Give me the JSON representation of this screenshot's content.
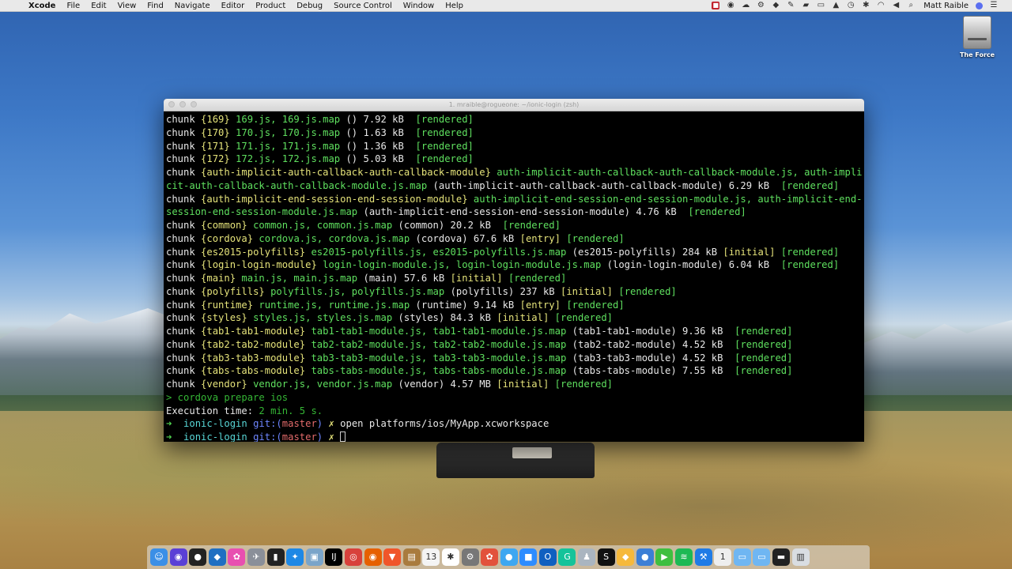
{
  "menubar": {
    "apple": "",
    "app_name": "Xcode",
    "items": [
      "File",
      "Edit",
      "View",
      "Find",
      "Navigate",
      "Editor",
      "Product",
      "Debug",
      "Source Control",
      "Window",
      "Help"
    ],
    "user": "Matt Raible"
  },
  "desktop": {
    "disk_label": "The Force"
  },
  "terminal": {
    "title": "1. mraible@rogueone: ~/ionic-login (zsh)",
    "lines": [
      [
        {
          "t": "chunk ",
          "c": "w"
        },
        {
          "t": "{169}",
          "c": "y"
        },
        {
          "t": " 169.js, 169.js.map ",
          "c": "g"
        },
        {
          "t": "() 7.92 kB ",
          "c": "w"
        },
        {
          "t": " [rendered]",
          "c": "g"
        }
      ],
      [
        {
          "t": "chunk ",
          "c": "w"
        },
        {
          "t": "{170}",
          "c": "y"
        },
        {
          "t": " 170.js, 170.js.map ",
          "c": "g"
        },
        {
          "t": "() 1.63 kB ",
          "c": "w"
        },
        {
          "t": " [rendered]",
          "c": "g"
        }
      ],
      [
        {
          "t": "chunk ",
          "c": "w"
        },
        {
          "t": "{171}",
          "c": "y"
        },
        {
          "t": " 171.js, 171.js.map ",
          "c": "g"
        },
        {
          "t": "() 1.36 kB ",
          "c": "w"
        },
        {
          "t": " [rendered]",
          "c": "g"
        }
      ],
      [
        {
          "t": "chunk ",
          "c": "w"
        },
        {
          "t": "{172}",
          "c": "y"
        },
        {
          "t": " 172.js, 172.js.map ",
          "c": "g"
        },
        {
          "t": "() 5.03 kB ",
          "c": "w"
        },
        {
          "t": " [rendered]",
          "c": "g"
        }
      ],
      [
        {
          "t": "chunk ",
          "c": "w"
        },
        {
          "t": "{auth-implicit-auth-callback-auth-callback-module}",
          "c": "y"
        },
        {
          "t": " auth-implicit-auth-callback-auth-callback-module.js, auth-impli",
          "c": "g"
        }
      ],
      [
        {
          "t": "cit-auth-callback-auth-callback-module.js.map ",
          "c": "g"
        },
        {
          "t": "(auth-implicit-auth-callback-auth-callback-module) 6.29 kB ",
          "c": "w"
        },
        {
          "t": " [rendered]",
          "c": "g"
        }
      ],
      [
        {
          "t": "chunk ",
          "c": "w"
        },
        {
          "t": "{auth-implicit-end-session-end-session-module}",
          "c": "y"
        },
        {
          "t": " auth-implicit-end-session-end-session-module.js, auth-implicit-end-",
          "c": "g"
        }
      ],
      [
        {
          "t": "session-end-session-module.js.map ",
          "c": "g"
        },
        {
          "t": "(auth-implicit-end-session-end-session-module) 4.76 kB ",
          "c": "w"
        },
        {
          "t": " [rendered]",
          "c": "g"
        }
      ],
      [
        {
          "t": "chunk ",
          "c": "w"
        },
        {
          "t": "{common}",
          "c": "y"
        },
        {
          "t": " common.js, common.js.map ",
          "c": "g"
        },
        {
          "t": "(common) 20.2 kB ",
          "c": "w"
        },
        {
          "t": " [rendered]",
          "c": "g"
        }
      ],
      [
        {
          "t": "chunk ",
          "c": "w"
        },
        {
          "t": "{cordova}",
          "c": "y"
        },
        {
          "t": " cordova.js, cordova.js.map ",
          "c": "g"
        },
        {
          "t": "(cordova) 67.6 kB ",
          "c": "w"
        },
        {
          "t": "[entry]",
          "c": "y"
        },
        {
          "t": " [rendered]",
          "c": "g"
        }
      ],
      [
        {
          "t": "chunk ",
          "c": "w"
        },
        {
          "t": "{es2015-polyfills}",
          "c": "y"
        },
        {
          "t": " es2015-polyfills.js, es2015-polyfills.js.map ",
          "c": "g"
        },
        {
          "t": "(es2015-polyfills) 284 kB ",
          "c": "w"
        },
        {
          "t": "[initial]",
          "c": "y"
        },
        {
          "t": " [rendered]",
          "c": "g"
        }
      ],
      [
        {
          "t": "chunk ",
          "c": "w"
        },
        {
          "t": "{login-login-module}",
          "c": "y"
        },
        {
          "t": " login-login-module.js, login-login-module.js.map ",
          "c": "g"
        },
        {
          "t": "(login-login-module) 6.04 kB ",
          "c": "w"
        },
        {
          "t": " [rendered]",
          "c": "g"
        }
      ],
      [
        {
          "t": "chunk ",
          "c": "w"
        },
        {
          "t": "{main}",
          "c": "y"
        },
        {
          "t": " main.js, main.js.map ",
          "c": "g"
        },
        {
          "t": "(main) 57.6 kB ",
          "c": "w"
        },
        {
          "t": "[initial]",
          "c": "y"
        },
        {
          "t": " [rendered]",
          "c": "g"
        }
      ],
      [
        {
          "t": "chunk ",
          "c": "w"
        },
        {
          "t": "{polyfills}",
          "c": "y"
        },
        {
          "t": " polyfills.js, polyfills.js.map ",
          "c": "g"
        },
        {
          "t": "(polyfills) 237 kB ",
          "c": "w"
        },
        {
          "t": "[initial]",
          "c": "y"
        },
        {
          "t": " [rendered]",
          "c": "g"
        }
      ],
      [
        {
          "t": "chunk ",
          "c": "w"
        },
        {
          "t": "{runtime}",
          "c": "y"
        },
        {
          "t": " runtime.js, runtime.js.map ",
          "c": "g"
        },
        {
          "t": "(runtime) 9.14 kB ",
          "c": "w"
        },
        {
          "t": "[entry]",
          "c": "y"
        },
        {
          "t": " [rendered]",
          "c": "g"
        }
      ],
      [
        {
          "t": "chunk ",
          "c": "w"
        },
        {
          "t": "{styles}",
          "c": "y"
        },
        {
          "t": " styles.js, styles.js.map ",
          "c": "g"
        },
        {
          "t": "(styles) 84.3 kB ",
          "c": "w"
        },
        {
          "t": "[initial]",
          "c": "y"
        },
        {
          "t": " [rendered]",
          "c": "g"
        }
      ],
      [
        {
          "t": "chunk ",
          "c": "w"
        },
        {
          "t": "{tab1-tab1-module}",
          "c": "y"
        },
        {
          "t": " tab1-tab1-module.js, tab1-tab1-module.js.map ",
          "c": "g"
        },
        {
          "t": "(tab1-tab1-module) 9.36 kB ",
          "c": "w"
        },
        {
          "t": " [rendered]",
          "c": "g"
        }
      ],
      [
        {
          "t": "chunk ",
          "c": "w"
        },
        {
          "t": "{tab2-tab2-module}",
          "c": "y"
        },
        {
          "t": " tab2-tab2-module.js, tab2-tab2-module.js.map ",
          "c": "g"
        },
        {
          "t": "(tab2-tab2-module) 4.52 kB ",
          "c": "w"
        },
        {
          "t": " [rendered]",
          "c": "g"
        }
      ],
      [
        {
          "t": "chunk ",
          "c": "w"
        },
        {
          "t": "{tab3-tab3-module}",
          "c": "y"
        },
        {
          "t": " tab3-tab3-module.js, tab3-tab3-module.js.map ",
          "c": "g"
        },
        {
          "t": "(tab3-tab3-module) 4.52 kB ",
          "c": "w"
        },
        {
          "t": " [rendered]",
          "c": "g"
        }
      ],
      [
        {
          "t": "chunk ",
          "c": "w"
        },
        {
          "t": "{tabs-tabs-module}",
          "c": "y"
        },
        {
          "t": " tabs-tabs-module.js, tabs-tabs-module.js.map ",
          "c": "g"
        },
        {
          "t": "(tabs-tabs-module) 7.55 kB ",
          "c": "w"
        },
        {
          "t": " [rendered]",
          "c": "g"
        }
      ],
      [
        {
          "t": "chunk ",
          "c": "w"
        },
        {
          "t": "{vendor}",
          "c": "y"
        },
        {
          "t": " vendor.js, vendor.js.map ",
          "c": "g"
        },
        {
          "t": "(vendor) 4.57 MB ",
          "c": "w"
        },
        {
          "t": "[initial]",
          "c": "y"
        },
        {
          "t": " [rendered]",
          "c": "g"
        }
      ],
      [
        {
          "t": "> cordova prepare ios",
          "c": "dg"
        }
      ],
      [
        {
          "t": "Execution time: ",
          "c": "w"
        },
        {
          "t": "2 min. 5 s.",
          "c": "dg"
        }
      ],
      [
        {
          "t": "➜ ",
          "c": "ar"
        },
        {
          "t": " ionic-login ",
          "c": "cyan"
        },
        {
          "t": "git:(",
          "c": "blue"
        },
        {
          "t": "master",
          "c": "red"
        },
        {
          "t": ")",
          "c": "blue"
        },
        {
          "t": " ✗ ",
          "c": "y"
        },
        {
          "t": "open platforms/ios/MyApp.xcworkspace",
          "c": "w"
        }
      ],
      [
        {
          "t": "➜ ",
          "c": "ar"
        },
        {
          "t": " ionic-login ",
          "c": "cyan"
        },
        {
          "t": "git:(",
          "c": "blue"
        },
        {
          "t": "master",
          "c": "red"
        },
        {
          "t": ")",
          "c": "blue"
        },
        {
          "t": " ✗ ",
          "c": "y"
        }
      ]
    ]
  },
  "dock": {
    "icons": [
      {
        "name": "finder-icon",
        "color": "#3b8fe6",
        "glyph": "☺"
      },
      {
        "name": "siri-icon",
        "color": "#5a3fd6",
        "glyph": "◉"
      },
      {
        "name": "github-icon",
        "color": "#222222",
        "glyph": "●"
      },
      {
        "name": "vscode-icon",
        "color": "#1f6fc2",
        "glyph": "◆"
      },
      {
        "name": "photos-icon",
        "color": "#e84fb0",
        "glyph": "✿"
      },
      {
        "name": "launchpad-icon",
        "color": "#8a8f99",
        "glyph": "✈"
      },
      {
        "name": "terminal-icon",
        "color": "#222222",
        "glyph": "▮"
      },
      {
        "name": "safari-icon",
        "color": "#1e88e5",
        "glyph": "✦"
      },
      {
        "name": "preview-icon",
        "color": "#7aa4c9",
        "glyph": "▣"
      },
      {
        "name": "intellij-icon",
        "color": "#000000",
        "glyph": "IJ"
      },
      {
        "name": "chrome-icon",
        "color": "#d8413b",
        "glyph": "◎"
      },
      {
        "name": "firefox-icon",
        "color": "#e66000",
        "glyph": "◉"
      },
      {
        "name": "brave-icon",
        "color": "#f0552a",
        "glyph": "▼"
      },
      {
        "name": "notes-icon",
        "color": "#a97b3e",
        "glyph": "▤"
      },
      {
        "name": "calendar-icon",
        "color": "#f4f4f4",
        "glyph": "13"
      },
      {
        "name": "slack-icon",
        "color": "#ffffff",
        "glyph": "✱"
      },
      {
        "name": "system-preferences-icon",
        "color": "#777777",
        "glyph": "⚙"
      },
      {
        "name": "photo-booth-icon",
        "color": "#e2523c",
        "glyph": "✿"
      },
      {
        "name": "messages-icon",
        "color": "#3ea7f1",
        "glyph": "●"
      },
      {
        "name": "zoom-icon",
        "color": "#2d8cff",
        "glyph": "■"
      },
      {
        "name": "outlook-icon",
        "color": "#1060c0",
        "glyph": "O"
      },
      {
        "name": "grammarly-icon",
        "color": "#15c39a",
        "glyph": "G"
      },
      {
        "name": "keynote-icon",
        "color": "#aab5c0",
        "glyph": "♟"
      },
      {
        "name": "sonos-icon",
        "color": "#111111",
        "glyph": "S"
      },
      {
        "name": "sketch-icon",
        "color": "#f6b93b",
        "glyph": "◆"
      },
      {
        "name": "tweetbot-icon",
        "color": "#3c7fd6",
        "glyph": "●"
      },
      {
        "name": "facetime-icon",
        "color": "#3fbf3f",
        "glyph": "▶"
      },
      {
        "name": "spotify-icon",
        "color": "#1db954",
        "glyph": "≋"
      },
      {
        "name": "xcode-icon",
        "color": "#1f7be6",
        "glyph": "⚒"
      },
      {
        "name": "1password-icon",
        "color": "#eeeeee",
        "glyph": "1"
      },
      {
        "name": "folder-icon",
        "color": "#6fb6f2",
        "glyph": "▭"
      },
      {
        "name": "downloads-folder-icon",
        "color": "#6fb6f2",
        "glyph": "▭"
      },
      {
        "name": "window-icon",
        "color": "#222222",
        "glyph": "▬"
      },
      {
        "name": "trash-icon",
        "color": "#d9dde2",
        "glyph": "▥"
      }
    ]
  }
}
